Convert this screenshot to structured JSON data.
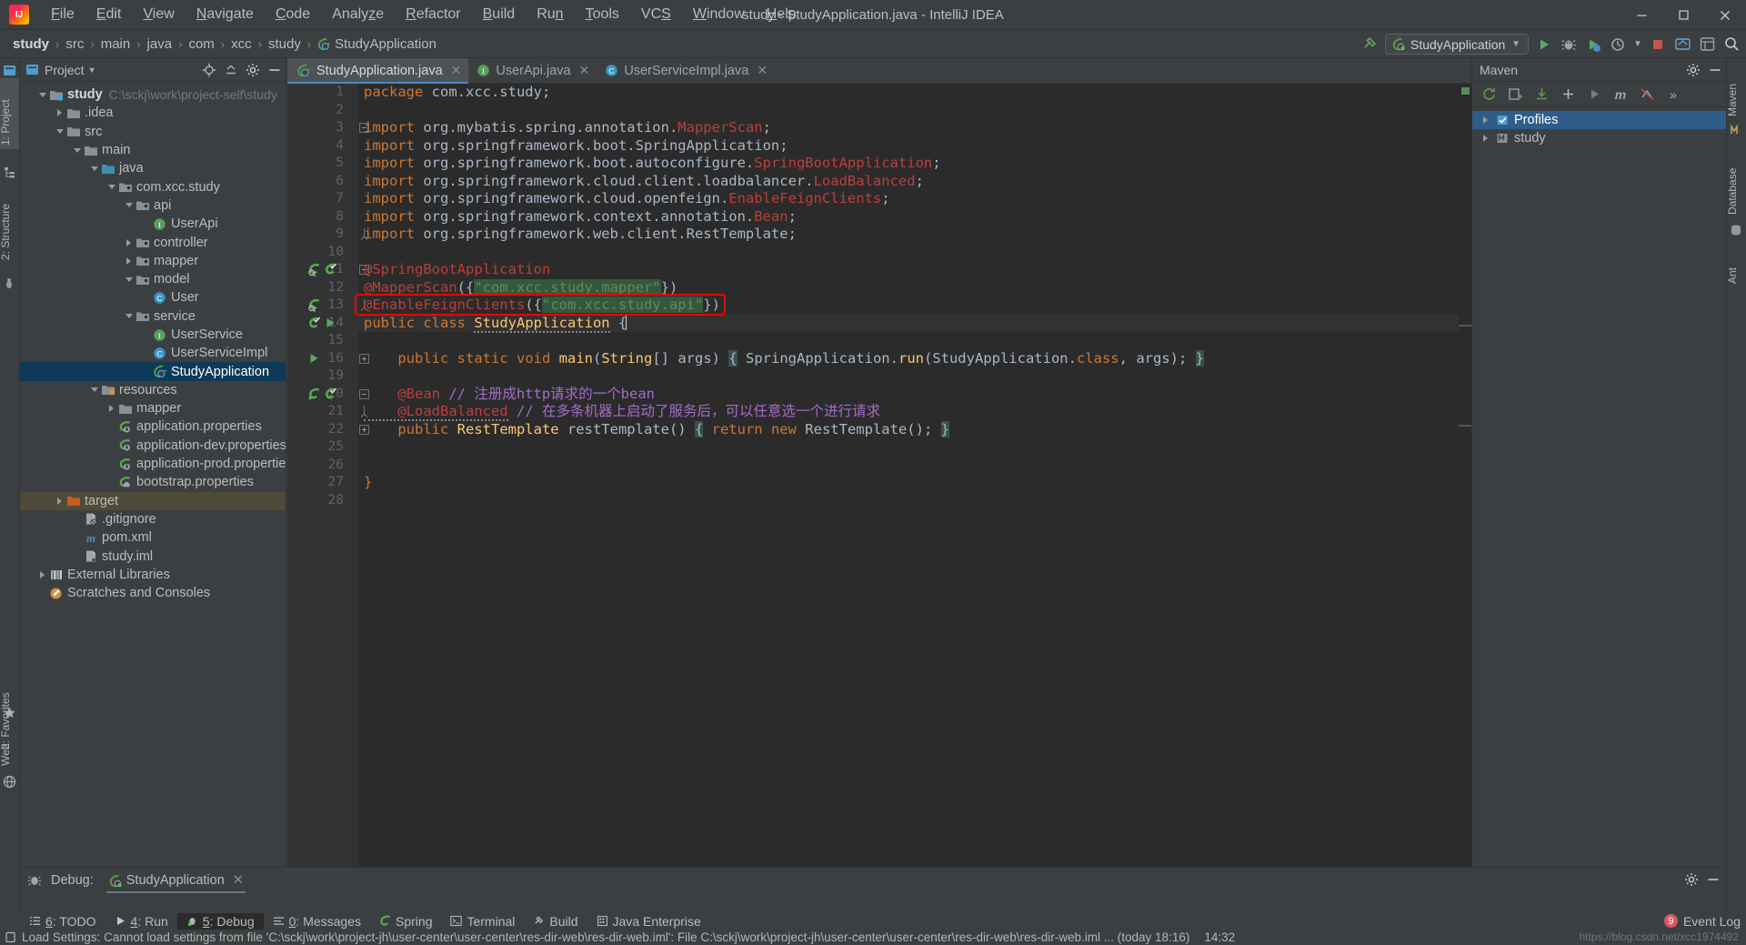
{
  "window": {
    "title": "study - StudyApplication.java - IntelliJ IDEA",
    "logo_icon": "intellij-idea-logo",
    "minimize_icon": "minimize-icon",
    "maximize_icon": "maximize-icon",
    "close_icon": "close-icon"
  },
  "menu": [
    {
      "label": "File",
      "mnemonic": "F"
    },
    {
      "label": "Edit",
      "mnemonic": "E"
    },
    {
      "label": "View",
      "mnemonic": "V"
    },
    {
      "label": "Navigate",
      "mnemonic": "N"
    },
    {
      "label": "Code",
      "mnemonic": "C"
    },
    {
      "label": "Analyze",
      "mnemonic": "z"
    },
    {
      "label": "Refactor",
      "mnemonic": "R"
    },
    {
      "label": "Build",
      "mnemonic": "B"
    },
    {
      "label": "Run",
      "mnemonic": "n"
    },
    {
      "label": "Tools",
      "mnemonic": "T"
    },
    {
      "label": "VCS",
      "mnemonic": "S"
    },
    {
      "label": "Window",
      "mnemonic": "W"
    },
    {
      "label": "Help",
      "mnemonic": "H"
    }
  ],
  "breadcrumb": {
    "items": [
      "study",
      "src",
      "main",
      "java",
      "com",
      "xcc",
      "study",
      "StudyApplication"
    ],
    "separator": "›",
    "last_icon": "spring-class-icon"
  },
  "toolbar": {
    "build_icon": "hammer-icon",
    "run_config_label": "StudyApplication",
    "run_config_icon": "spring-boot-run-icon",
    "dropdown_icon": "chevron-down-icon",
    "run_icon": "run-play-icon",
    "debug_icon": "debug-bug-icon",
    "run_coverage_icon": "run-with-coverage-icon",
    "profile_icon": "profiler-icon",
    "stop_icon": "stop-icon",
    "updates_icon": "update-project-icon",
    "settings_icon": "settings-icon",
    "search_icon": "search-everywhere-icon"
  },
  "left_stripe": {
    "tabs": [
      {
        "label": "1: Project",
        "icon": "project-icon",
        "active": true
      },
      {
        "label": "2: Structure",
        "icon": "structure-icon",
        "active": false
      },
      {
        "label": "2: Favorites",
        "icon": "favorites-star-icon",
        "active": false
      },
      {
        "label": "Web",
        "icon": "web-icon",
        "active": false
      }
    ]
  },
  "right_stripe": {
    "tabs": [
      {
        "label": "Maven",
        "icon": "maven-icon"
      },
      {
        "label": "Database",
        "icon": "database-icon"
      },
      {
        "label": "Ant",
        "icon": "ant-icon"
      }
    ]
  },
  "project_panel": {
    "title": "Project",
    "title_dropdown_icon": "chevron-down-icon",
    "actions": [
      {
        "icon": "locate-target-icon",
        "name": "select-opened-file"
      },
      {
        "icon": "collapse-all-icon",
        "name": "collapse-all"
      },
      {
        "icon": "gear-icon",
        "name": "panel-settings"
      },
      {
        "icon": "hide-icon",
        "name": "hide-panel"
      }
    ],
    "tree": [
      {
        "label": "study",
        "path": "C:\\sckj\\work\\project-self\\study",
        "depth": 0,
        "arrow": "open",
        "icon": "module-root-icon",
        "bold": true
      },
      {
        "label": ".idea",
        "depth": 1,
        "arrow": "closed",
        "icon": "folder-icon"
      },
      {
        "label": "src",
        "depth": 1,
        "arrow": "open",
        "icon": "folder-icon"
      },
      {
        "label": "main",
        "depth": 2,
        "arrow": "open",
        "icon": "folder-icon"
      },
      {
        "label": "java",
        "depth": 3,
        "arrow": "open",
        "icon": "source-root-icon"
      },
      {
        "label": "com.xcc.study",
        "depth": 4,
        "arrow": "open",
        "icon": "package-icon"
      },
      {
        "label": "api",
        "depth": 5,
        "arrow": "open",
        "icon": "package-icon"
      },
      {
        "label": "UserApi",
        "depth": 6,
        "arrow": "none",
        "icon": "interface-icon"
      },
      {
        "label": "controller",
        "depth": 5,
        "arrow": "closed",
        "icon": "package-icon"
      },
      {
        "label": "mapper",
        "depth": 5,
        "arrow": "closed",
        "icon": "package-icon"
      },
      {
        "label": "model",
        "depth": 5,
        "arrow": "open",
        "icon": "package-icon"
      },
      {
        "label": "User",
        "depth": 6,
        "arrow": "none",
        "icon": "class-icon"
      },
      {
        "label": "service",
        "depth": 5,
        "arrow": "open",
        "icon": "package-icon"
      },
      {
        "label": "UserService",
        "depth": 6,
        "arrow": "none",
        "icon": "interface-icon"
      },
      {
        "label": "UserServiceImpl",
        "depth": 6,
        "arrow": "none",
        "icon": "class-icon"
      },
      {
        "label": "StudyApplication",
        "depth": 6,
        "arrow": "none",
        "icon": "spring-class-icon",
        "selected": true
      },
      {
        "label": "resources",
        "depth": 3,
        "arrow": "open",
        "icon": "resource-root-icon"
      },
      {
        "label": "mapper",
        "depth": 4,
        "arrow": "closed",
        "icon": "folder-icon"
      },
      {
        "label": "application.properties",
        "depth": 4,
        "arrow": "none",
        "icon": "spring-properties-icon"
      },
      {
        "label": "application-dev.properties",
        "depth": 4,
        "arrow": "none",
        "icon": "spring-properties-icon"
      },
      {
        "label": "application-prod.properties",
        "depth": 4,
        "arrow": "none",
        "icon": "spring-properties-icon"
      },
      {
        "label": "bootstrap.properties",
        "depth": 4,
        "arrow": "none",
        "icon": "spring-cloud-properties-icon"
      },
      {
        "label": "target",
        "depth": 1,
        "arrow": "closed",
        "icon": "excluded-folder-icon",
        "highlight": true
      },
      {
        "label": ".gitignore",
        "depth": 2,
        "arrow": "none",
        "icon": "gitignore-file-icon"
      },
      {
        "label": "pom.xml",
        "depth": 2,
        "arrow": "none",
        "icon": "maven-pom-icon"
      },
      {
        "label": "study.iml",
        "depth": 2,
        "arrow": "none",
        "icon": "iml-file-icon"
      },
      {
        "label": "External Libraries",
        "depth": 0,
        "arrow": "closed",
        "icon": "libraries-icon"
      },
      {
        "label": "Scratches and Consoles",
        "depth": 0,
        "arrow": "none",
        "icon": "scratches-icon"
      }
    ]
  },
  "editor": {
    "tabs": [
      {
        "label": "StudyApplication.java",
        "icon": "spring-class-icon",
        "active": true,
        "close_icon": "close-icon"
      },
      {
        "label": "UserApi.java",
        "icon": "interface-icon",
        "active": false,
        "close_icon": "close-icon"
      },
      {
        "label": "UserServiceImpl.java",
        "icon": "class-icon",
        "active": false,
        "close_icon": "close-icon"
      }
    ],
    "caret_line": 14,
    "lines": [
      {
        "num": "1",
        "tokens": [
          {
            "t": "package ",
            "c": "kw"
          },
          {
            "t": "com.xcc.study;",
            "c": "ident"
          }
        ]
      },
      {
        "num": "2",
        "tokens": []
      },
      {
        "num": "3",
        "fold": "minus",
        "tokens": [
          {
            "t": "import ",
            "c": "kw"
          },
          {
            "t": "org.mybatis.spring.annotation.",
            "c": "pkg"
          },
          {
            "t": "MapperScan",
            "c": "err"
          },
          {
            "t": ";",
            "c": "pkg"
          }
        ]
      },
      {
        "num": "4",
        "tokens": [
          {
            "t": "import ",
            "c": "kw"
          },
          {
            "t": "org.springframework.boot.SpringApplication;",
            "c": "pkg"
          }
        ]
      },
      {
        "num": "5",
        "tokens": [
          {
            "t": "import ",
            "c": "kw"
          },
          {
            "t": "org.springframework.boot.autoconfigure.",
            "c": "pkg"
          },
          {
            "t": "SpringBootApplication",
            "c": "err"
          },
          {
            "t": ";",
            "c": "pkg"
          }
        ]
      },
      {
        "num": "6",
        "tokens": [
          {
            "t": "import ",
            "c": "kw"
          },
          {
            "t": "org.springframework.cloud.client.loadbalancer.",
            "c": "pkg"
          },
          {
            "t": "LoadBalanced",
            "c": "err"
          },
          {
            "t": ";",
            "c": "pkg"
          }
        ]
      },
      {
        "num": "7",
        "tokens": [
          {
            "t": "import ",
            "c": "kw"
          },
          {
            "t": "org.springframework.cloud.openfeign.",
            "c": "pkg"
          },
          {
            "t": "EnableFeignClients",
            "c": "err"
          },
          {
            "t": ";",
            "c": "pkg"
          }
        ]
      },
      {
        "num": "8",
        "tokens": [
          {
            "t": "import ",
            "c": "kw"
          },
          {
            "t": "org.springframework.context.annotation.",
            "c": "pkg"
          },
          {
            "t": "Bean",
            "c": "err"
          },
          {
            "t": ";",
            "c": "pkg"
          }
        ]
      },
      {
        "num": "9",
        "fold": "end",
        "tokens": [
          {
            "t": "import ",
            "c": "kw"
          },
          {
            "t": "org.springframework.web.client.RestTemplate;",
            "c": "pkg"
          }
        ]
      },
      {
        "num": "10",
        "tokens": []
      },
      {
        "num": "11",
        "fold": "minus",
        "gutter_icons": [
          "bean-icon",
          "spring-checked-icon"
        ],
        "tokens": [
          {
            "t": "@SpringBootApplication",
            "c": "err"
          }
        ]
      },
      {
        "num": "12",
        "tokens": [
          {
            "t": "@MapperScan",
            "c": "err"
          },
          {
            "t": "({",
            "c": "ident"
          },
          {
            "t": "\"com.xcc.study.mapper\"",
            "c": "str"
          },
          {
            "t": "})",
            "c": "ident"
          }
        ]
      },
      {
        "num": "13",
        "fold": "end",
        "gutter_icons": [
          "bean-icon"
        ],
        "boxed": true,
        "tokens": [
          {
            "t": "@EnableFeignClients",
            "c": "err"
          },
          {
            "t": "({",
            "c": "ident"
          },
          {
            "t": "\"com.xcc.study.api\"",
            "c": "str"
          },
          {
            "t": "})",
            "c": "ident"
          }
        ]
      },
      {
        "num": "14",
        "gutter_icons": [
          "spring-checked-icon",
          "run-icon"
        ],
        "tokens": [
          {
            "t": "public ",
            "c": "kw"
          },
          {
            "t": "class ",
            "c": "kw"
          },
          {
            "t": "StudyApplication",
            "c": "cls-squiggle"
          },
          {
            "t": " {",
            "c": "ident"
          }
        ]
      },
      {
        "num": "15",
        "tokens": []
      },
      {
        "num": "16",
        "fold": "plus",
        "gutter_icons": [
          "run-icon"
        ],
        "tokens": [
          {
            "t": "    public ",
            "c": "kw"
          },
          {
            "t": "static ",
            "c": "kw"
          },
          {
            "t": "void ",
            "c": "kw"
          },
          {
            "t": "main",
            "c": "cls"
          },
          {
            "t": "(",
            "c": "ident"
          },
          {
            "t": "String",
            "c": "cls"
          },
          {
            "t": "[] ",
            "c": "ident"
          },
          {
            "t": "args",
            "c": "param"
          },
          {
            "t": ") ",
            "c": "ident"
          },
          {
            "t": "{",
            "c": "brace"
          },
          {
            "t": " SpringApplication.",
            "c": "ident"
          },
          {
            "t": "run",
            "c": "cls"
          },
          {
            "t": "(StudyApplication.",
            "c": "ident"
          },
          {
            "t": "class",
            "c": "kw"
          },
          {
            "t": ", ",
            "c": "ident"
          },
          {
            "t": "args",
            "c": "param"
          },
          {
            "t": "); ",
            "c": "ident"
          },
          {
            "t": "}",
            "c": "brace"
          }
        ]
      },
      {
        "num": "19",
        "tokens": []
      },
      {
        "num": "20",
        "fold": "minus",
        "gutter_icons": [
          "bean-arrow-icon",
          "spring-checked-icon"
        ],
        "tokens": [
          {
            "t": "    @Bean",
            "c": "err"
          },
          {
            "t": " ",
            "c": "ident"
          },
          {
            "t": "// 注册成http请求的一个bean",
            "c": "cmt-purple"
          }
        ]
      },
      {
        "num": "21",
        "fold": "end",
        "tokens": [
          {
            "t": "    @LoadBalanced",
            "c": "err-squiggle"
          },
          {
            "t": " ",
            "c": "ident"
          },
          {
            "t": "// 在多条机器上启动了服务后，可以任意选一个进行请求",
            "c": "cmt-purple"
          }
        ]
      },
      {
        "num": "22",
        "fold": "plus",
        "tokens": [
          {
            "t": "    public ",
            "c": "kw"
          },
          {
            "t": "RestTemplate",
            "c": "cls"
          },
          {
            "t": " restTemplate() ",
            "c": "ident"
          },
          {
            "t": "{",
            "c": "brace"
          },
          {
            "t": " ",
            "c": "ident"
          },
          {
            "t": "return ",
            "c": "kw"
          },
          {
            "t": "new ",
            "c": "kw"
          },
          {
            "t": "RestTemplate",
            "c": "ident"
          },
          {
            "t": "(); ",
            "c": "ident"
          },
          {
            "t": "}",
            "c": "brace"
          }
        ]
      },
      {
        "num": "25",
        "tokens": []
      },
      {
        "num": "26",
        "tokens": []
      },
      {
        "num": "27",
        "tokens": [
          {
            "t": "}",
            "c": "kw"
          }
        ]
      },
      {
        "num": "28",
        "tokens": []
      }
    ]
  },
  "maven_panel": {
    "title": "Maven",
    "settings_icon": "gear-icon",
    "hide_icon": "hide-icon",
    "toolbar": [
      {
        "icon": "refresh-icon",
        "name": "reload-all-maven-projects"
      },
      {
        "icon": "add-plugin-icon",
        "name": "generate-sources"
      },
      {
        "icon": "download-icon",
        "name": "download-sources"
      },
      {
        "icon": "plus-icon",
        "name": "add-maven-project"
      },
      {
        "icon": "run-icon",
        "name": "execute-maven-goal"
      },
      {
        "icon": "m-icon",
        "name": "toggle-offline-mode"
      },
      {
        "icon": "skip-tests-icon",
        "name": "toggle-skip-tests"
      },
      {
        "icon": "more-icon",
        "name": "more-options"
      }
    ],
    "tree": [
      {
        "label": "Profiles",
        "arrow": "closed",
        "icon": "profiles-icon",
        "selected": true,
        "depth": 0
      },
      {
        "label": "study",
        "arrow": "closed",
        "icon": "maven-module-icon",
        "selected": false,
        "depth": 0
      }
    ]
  },
  "debug_panel": {
    "label": "Debug:",
    "icon": "debug-icon",
    "session_tab": "StudyApplication",
    "session_icon": "spring-boot-run-icon",
    "close_icon": "close-icon",
    "settings_icon": "gear-icon",
    "hide_icon": "hide-icon"
  },
  "bottom_tabs": [
    {
      "label": "6: TODO",
      "mnemonic": "6",
      "icon": "todo-icon",
      "active": false
    },
    {
      "label": "4: Run",
      "mnemonic": "4",
      "icon": "run-icon",
      "active": false
    },
    {
      "label": "5: Debug",
      "mnemonic": "5",
      "icon": "debug-icon",
      "active": true
    },
    {
      "label": "0: Messages",
      "mnemonic": "0",
      "icon": "messages-icon",
      "active": false
    },
    {
      "label": "Spring",
      "icon": "spring-icon",
      "active": false
    },
    {
      "label": "Terminal",
      "icon": "terminal-icon",
      "active": false
    },
    {
      "label": "Build",
      "icon": "build-icon",
      "active": false
    },
    {
      "label": "Java Enterprise",
      "icon": "java-enterprise-icon",
      "active": false
    }
  ],
  "event_log": {
    "label": "Event Log",
    "badge": "9"
  },
  "status_bar": {
    "icon": "notification-icon",
    "message": "Load Settings: Cannot load settings from file 'C:\\sckj\\work\\project-jh\\user-center\\user-center\\res-dir-web\\res-dir-web.iml': File C:\\sckj\\work\\project-jh\\user-center\\user-center\\res-dir-web\\res-dir-web.iml ... (today 18:16)",
    "time": "14:32",
    "watermark": "https://blog.csdn.net/xcc1974492"
  }
}
